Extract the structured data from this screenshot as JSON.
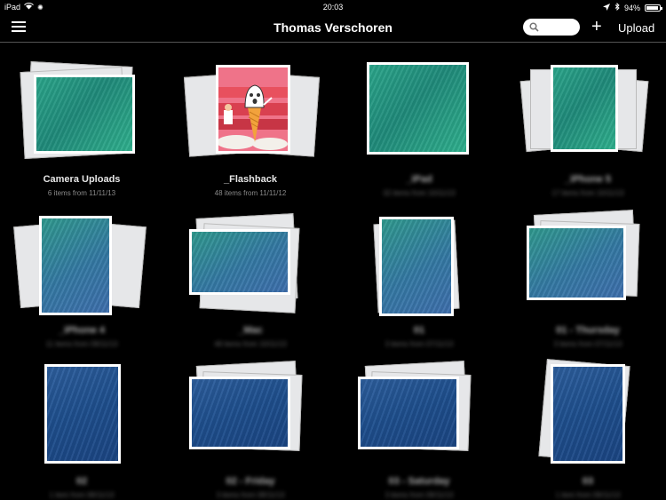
{
  "status": {
    "device": "iPad",
    "time": "20:03",
    "battery": "94%",
    "battery_level": 0.94
  },
  "navbar": {
    "title": "Thomas Verschoren",
    "search_placeholder": "",
    "add_label": "+",
    "upload_label": "Upload"
  },
  "albums": [
    {
      "title": "Camera Uploads",
      "subtitle": "6 items from 11/11/13",
      "style": "teal"
    },
    {
      "title": "_Flashback",
      "subtitle": "48 items from 11/11/12",
      "style": "flash"
    },
    {
      "title": "_iPad",
      "subtitle": "32 items from 10/11/13",
      "style": "teal"
    },
    {
      "title": "_iPhone 5",
      "subtitle": "17 items from 10/11/13",
      "style": "teal"
    },
    {
      "title": "_iPhone 4",
      "subtitle": "11 items from 09/11/13",
      "style": "teal-blue"
    },
    {
      "title": "_Mac",
      "subtitle": "48 items from 10/11/13",
      "style": "teal-blue"
    },
    {
      "title": "01",
      "subtitle": "3 items from 07/11/13",
      "style": "teal-blue"
    },
    {
      "title": "01 - Thursday",
      "subtitle": "3 items from 07/11/13",
      "style": "teal-blue"
    },
    {
      "title": "02",
      "subtitle": "1 item from 08/11/13",
      "style": "blue"
    },
    {
      "title": "02 - Friday",
      "subtitle": "3 items from 08/11/13",
      "style": "blue"
    },
    {
      "title": "03 - Saturday",
      "subtitle": "3 items from 09/11/13",
      "style": "blue"
    },
    {
      "title": "03",
      "subtitle": "1 item from 09/11/13",
      "style": "blue"
    }
  ]
}
